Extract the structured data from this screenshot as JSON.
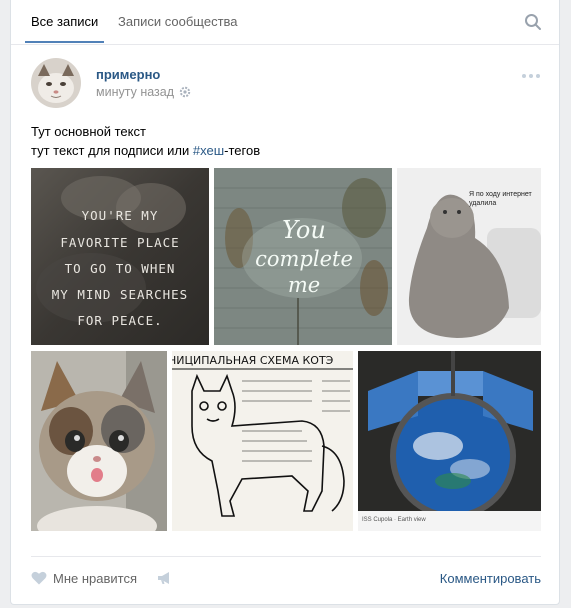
{
  "tabs": [
    {
      "label": "Все записи",
      "active": true
    },
    {
      "label": "Записи сообщества",
      "active": false
    }
  ],
  "post": {
    "author": "примерно",
    "time": "минуту назад",
    "text_line1": "Тут основной текст",
    "text_line2_prefix": "тут текст для подписи или ",
    "hashtag": "#хеш",
    "text_line2_suffix": "-тегов"
  },
  "photos": {
    "quote_lines": [
      "YOU'RE MY",
      "FAVORITE PLACE",
      "TO GO TO WHEN",
      "MY MIND SEARCHES",
      "FOR PEACE."
    ],
    "neon_lines": [
      "You",
      "complete",
      "me"
    ],
    "seal_caption_line1": "Я по ходу интернет",
    "seal_caption_line2": "удалила",
    "scheme_title": "НИЦИПАЛЬНАЯ СХЕМА КОТЭ",
    "space_caption": "ISS Cupola · Earth view"
  },
  "actions": {
    "like_label": "Мне нравится",
    "comment_label": "Комментировать"
  },
  "colors": {
    "link": "#2a5885",
    "accent": "#5181b8",
    "muted": "#939393",
    "background": "#edeef0"
  }
}
